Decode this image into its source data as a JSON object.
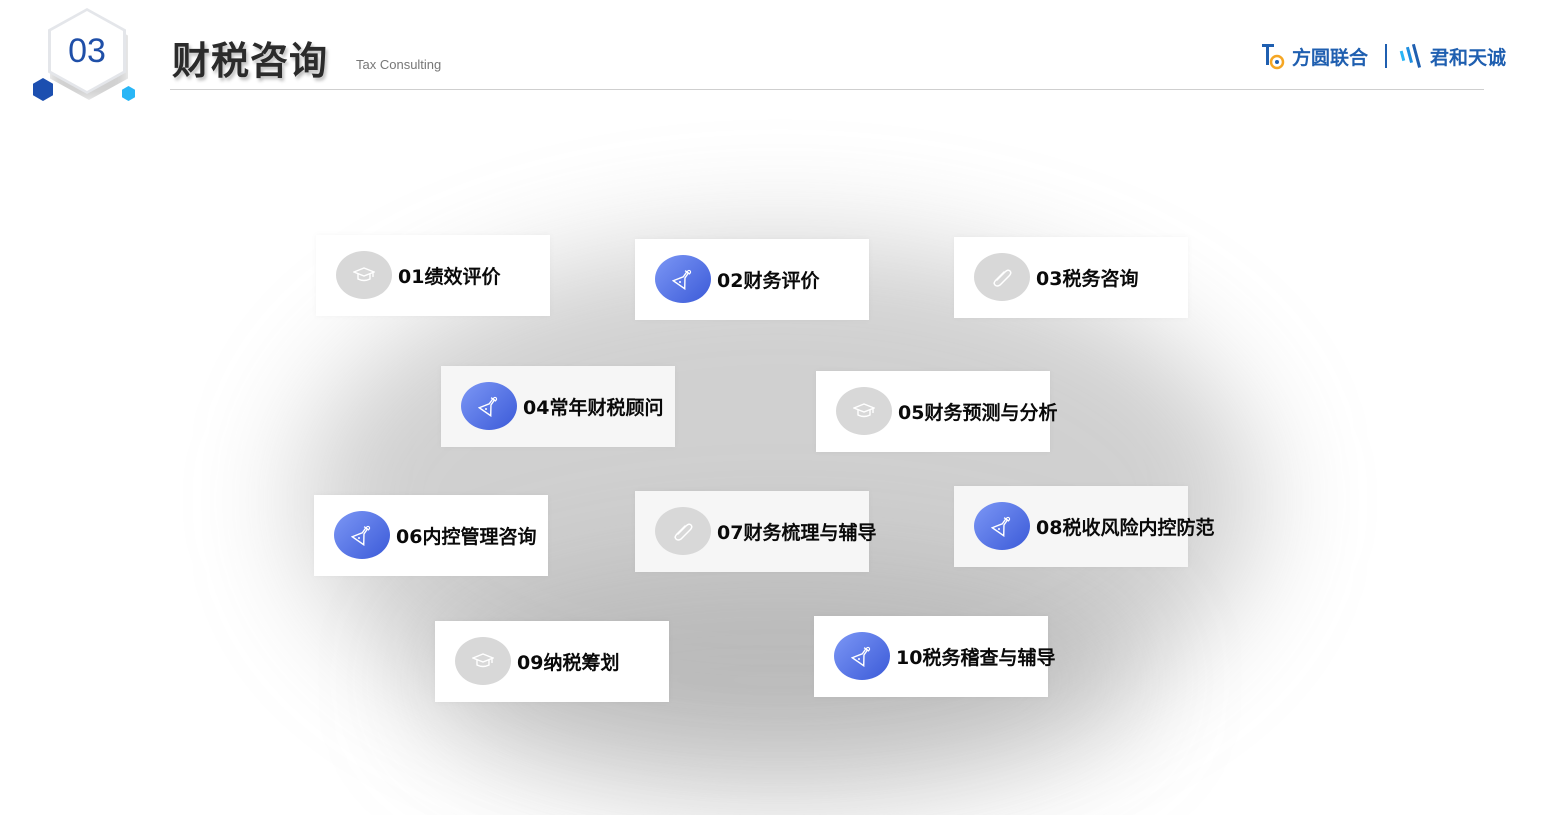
{
  "header": {
    "section_number": "03",
    "title": "财税咨询",
    "subtitle": "Tax Consulting",
    "brand_primary": "方圆联合",
    "brand_secondary": "君和天诚"
  },
  "colors": {
    "accent_blue": "#3b5ad8",
    "brand_blue": "#1f5fb0",
    "icon_gray": "#d8d8d8"
  },
  "services": [
    {
      "label": "01绩效评价",
      "icon": "graduation-cap-icon",
      "style": "gray"
    },
    {
      "label": "02财务评价",
      "icon": "flask-icon",
      "style": "blue"
    },
    {
      "label": "03税务咨询",
      "icon": "paperclip-icon",
      "style": "gray"
    },
    {
      "label": "04常年财税顾问",
      "icon": "flask-icon",
      "style": "blue"
    },
    {
      "label": "05财务预测与分析",
      "icon": "graduation-cap-icon",
      "style": "gray"
    },
    {
      "label": "06内控管理咨询",
      "icon": "flask-icon",
      "style": "blue"
    },
    {
      "label": "07财务梳理与辅导",
      "icon": "paperclip-icon",
      "style": "gray"
    },
    {
      "label": "08税收风险内控防范",
      "icon": "flask-icon",
      "style": "blue"
    },
    {
      "label": "09纳税筹划",
      "icon": "graduation-cap-icon",
      "style": "gray"
    },
    {
      "label": "10税务稽查与辅导",
      "icon": "flask-icon",
      "style": "blue"
    }
  ]
}
